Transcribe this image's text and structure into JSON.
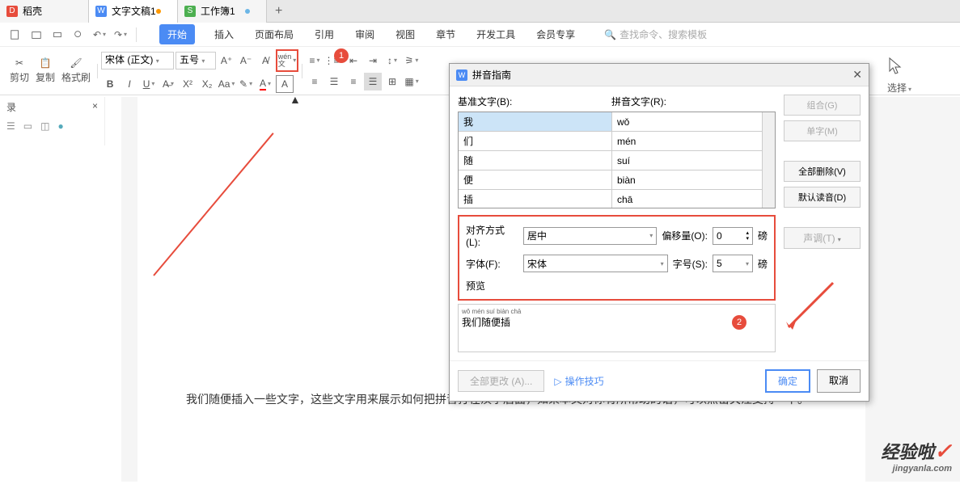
{
  "tabs": {
    "t0": "稻壳",
    "t1": "文字文稿1",
    "t2": "工作簿1"
  },
  "menu": {
    "start": "开始",
    "insert": "插入",
    "layout": "页面布局",
    "ref": "引用",
    "review": "审阅",
    "view": "视图",
    "chapter": "章节",
    "dev": "开发工具",
    "member": "会员专享"
  },
  "search_placeholder": "查找命令、搜索模板",
  "toolbar": {
    "cut": "剪切",
    "copy": "复制",
    "brush": "格式刷",
    "font": "宋体 (正文)",
    "size": "五号",
    "select": "选择"
  },
  "side": {
    "title": "录"
  },
  "doc": {
    "p1": "我们随便插入一些文字，这些文字用来展示如何把拼音打在汉字后面，如果本文对你有所帮助的话，可以点击关注支持一下。"
  },
  "dialog": {
    "title": "拼音指南",
    "base_label": "基准文字(B):",
    "ruby_label": "拼音文字(R):",
    "rows": [
      {
        "char": "我",
        "py": "wǒ"
      },
      {
        "char": "们",
        "py": "mén"
      },
      {
        "char": "随",
        "py": "suí"
      },
      {
        "char": "便",
        "py": "biàn"
      },
      {
        "char": "插",
        "py": "chā"
      }
    ],
    "align_label": "对齐方式(L):",
    "align_value": "居中",
    "offset_label": "偏移量(O):",
    "offset_value": "0",
    "font_label": "字体(F):",
    "font_value": "宋体",
    "fontsize_label": "字号(S):",
    "fontsize_value": "5",
    "unit": "磅",
    "preview_label": "预览",
    "preview_ruby": "wǒ  mén  suí  biàn chā",
    "preview_text": "我们随便插",
    "combine": "组合(G)",
    "single": "单字(M)",
    "clear_all": "全部删除(V)",
    "default": "默认读音(D)",
    "tone": "声调(T)",
    "change_all": "全部更改 (A)...",
    "tips": "操作技巧",
    "ok": "确定",
    "cancel": "取消"
  },
  "badges": {
    "b1": "1",
    "b2": "2"
  },
  "watermark": {
    "w1": "经验啦",
    "w2": "jingyanla.com"
  }
}
